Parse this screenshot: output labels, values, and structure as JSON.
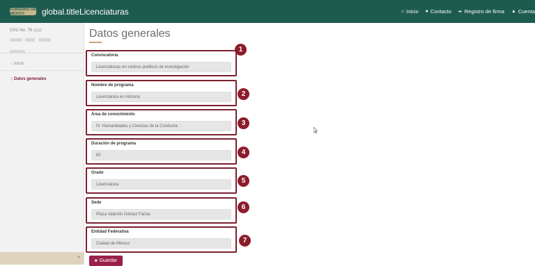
{
  "header": {
    "logo_text": "GOBIERNO DE MÉXICO",
    "app_title": "global.titleLicenciaturas",
    "nav": [
      {
        "icon": "home-icon",
        "glyph": "⌂",
        "label": "Inicio"
      },
      {
        "icon": "chat-icon",
        "glyph": "●",
        "label": "Contacto"
      },
      {
        "icon": "signature-icon",
        "glyph": "✒",
        "label": "Registro de firma"
      },
      {
        "icon": "user-icon",
        "glyph": "▲",
        "label": "Cuenta"
      }
    ]
  },
  "sidebar": {
    "cvu_label": "CVU No. 78",
    "items": [
      {
        "label": "Inicio",
        "icon": "home-icon"
      },
      {
        "label": "Datos generales",
        "icon": "document-icon"
      }
    ],
    "collapse_glyph": "«"
  },
  "main": {
    "title": "Datos generales",
    "fields": [
      {
        "number": "1",
        "label": "Convocatoria",
        "value": "Licenciaturas en centros publicos de investigación"
      },
      {
        "number": "2",
        "label": "Nombre de programa",
        "value": "Licenciatura en Historia"
      },
      {
        "number": "3",
        "label": "Área de conocimiento",
        "value": "IV. Humanidades y Ciencias de la Conducta"
      },
      {
        "number": "4",
        "label": "Duración de programa",
        "value": "60"
      },
      {
        "number": "5",
        "label": "Grado",
        "value": "Licenciatura"
      },
      {
        "number": "6",
        "label": "Sede",
        "value": "Plaza Valentín Gómez Farías"
      },
      {
        "number": "7",
        "label": "Entidad Federativa",
        "value": "Ciudad de México"
      }
    ],
    "save_label": "Guardar"
  },
  "colors": {
    "header_bg": "#1e5b4f",
    "accent": "#9b1f4a",
    "badge": "#8b1c2c",
    "field_border": "#7b1f2f"
  }
}
